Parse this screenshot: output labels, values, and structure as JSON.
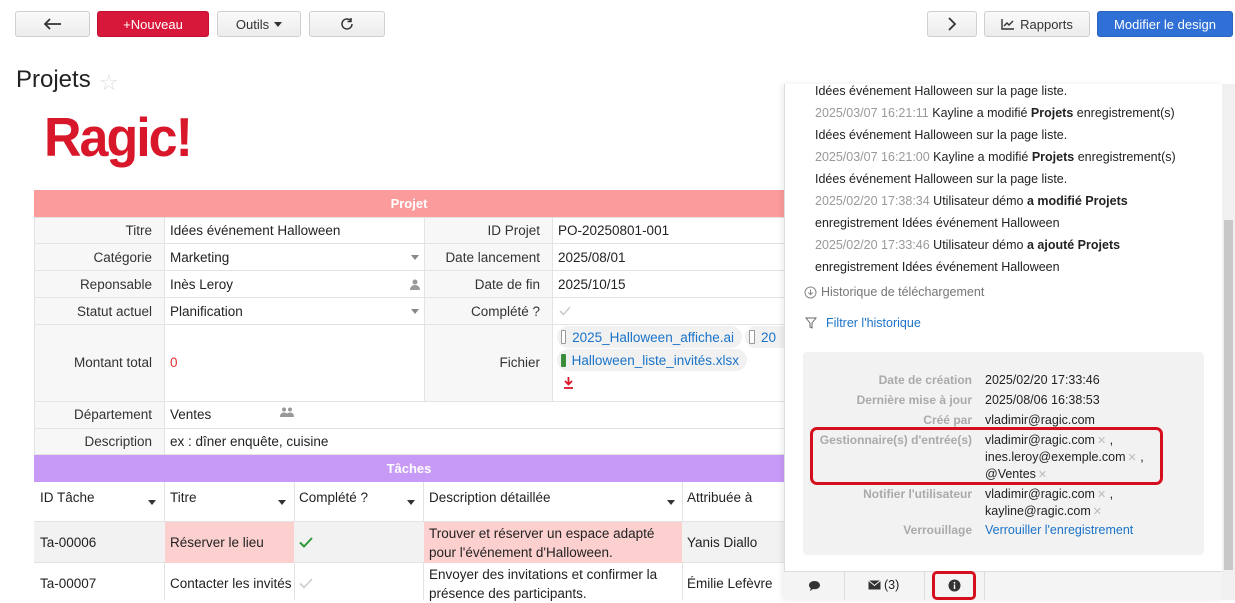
{
  "toolbar": {
    "back_icon": "arrow-left-icon",
    "new_label": "+Nouveau",
    "tools_label": "Outils",
    "refresh_icon": "refresh-icon",
    "next_icon": "chevron-right-icon",
    "reports_label": "Rapports",
    "design_label": "Modifier le design"
  },
  "page": {
    "title": "Projets",
    "logo_text": "Ragic!"
  },
  "form": {
    "section_projet": "Projet",
    "section_taches": "Tâches",
    "fields": {
      "titre_label": "Titre",
      "titre_value": "Idées événement Halloween",
      "categorie_label": "Catégorie",
      "categorie_value": "Marketing",
      "responsable_label": "Reponsable",
      "responsable_value": "Inès Leroy",
      "statut_label": "Statut actuel",
      "statut_value": "Planification",
      "montant_label": "Montant total",
      "montant_value": "0",
      "departement_label": "Département",
      "departement_value": "Ventes",
      "description_label": "Description",
      "description_value": "ex : dîner enquête, cuisine",
      "id_label": "ID Projet",
      "id_value": "PO-20250801-001",
      "date_lancement_label": "Date lancement",
      "date_lancement_value": "2025/08/01",
      "date_fin_label": "Date de fin",
      "date_fin_value": "2025/10/15",
      "complete_label": "Complété ?",
      "fichier_label": "Fichier",
      "files": [
        "2025_Halloween_affiche.ai",
        "20",
        "Halloween_liste_invités.xlsx"
      ]
    }
  },
  "tasks": {
    "headers": [
      "ID Tâche",
      "Titre",
      "Complété ?",
      "Description détaillée",
      "Attribuée à"
    ],
    "rows": [
      {
        "id": "Ta-00006",
        "titre": "Réserver le lieu",
        "desc1": "Trouver et réserver un espace adapté",
        "desc2": "pour l'événement d'Halloween.",
        "assignee": "Yanis Diallo"
      },
      {
        "id": "Ta-00007",
        "titre": "Contacter les invités",
        "desc1": "Envoyer des invitations et confirmer la",
        "desc2": "présence des participants.",
        "assignee": "Émilie Lefèvre"
      }
    ]
  },
  "panel": {
    "logs": [
      {
        "ts": "",
        "before": "",
        "bold": "",
        "after": "Idées événement Halloween sur la page liste."
      },
      {
        "ts": "2025/03/07 16:21:11",
        "before": " Kayline a modifié ",
        "bold": "Projets",
        "after": " enregistrement(s)"
      },
      {
        "ts": "",
        "before": "",
        "bold": "",
        "after": "Idées événement Halloween sur la page liste."
      },
      {
        "ts": "2025/03/07 16:21:00",
        "before": " Kayline a modifié ",
        "bold": "Projets",
        "after": " enregistrement(s)"
      },
      {
        "ts": "",
        "before": "",
        "bold": "",
        "after": "Idées événement Halloween sur la page liste."
      },
      {
        "ts": "2025/02/20 17:38:34",
        "before": " Utilisateur démo ",
        "bold": "a modifié Projets",
        "after": ""
      },
      {
        "ts": "",
        "before": "",
        "bold": "",
        "after": "enregistrement Idées événement Halloween"
      },
      {
        "ts": "2025/02/20 17:33:46",
        "before": " Utilisateur démo ",
        "bold": "a ajouté Projets",
        "after": ""
      },
      {
        "ts": "",
        "before": "",
        "bold": "",
        "after": "enregistrement Idées événement Halloween"
      }
    ],
    "download_history": "Historique de téléchargement",
    "filter_history": "Filtrer l'historique",
    "meta": {
      "created_label": "Date de création",
      "created_value": "2025/02/20 17:33:46",
      "updated_label": "Dernière mise à jour",
      "updated_value": "2025/08/06 16:38:53",
      "creator_label": "Créé par",
      "creator_value": "vladimir@ragic.com",
      "managers_label": "Gestionnaire(s) d'entrée(s)",
      "managers": [
        "vladimir@ragic.com",
        "ines.leroy@exemple.com",
        "@Ventes"
      ],
      "notify_label": "Notifier l'utilisateur",
      "notify": [
        "vladimir@ragic.com",
        "kayline@ragic.com"
      ],
      "lock_label": "Verrouillage",
      "lock_value": "Verrouiller l'enregistrement"
    },
    "bottom": {
      "comment_icon": "comment-icon",
      "mail_icon": "mail-icon",
      "mail_count": "(3)",
      "info_icon": "info-icon"
    }
  }
}
